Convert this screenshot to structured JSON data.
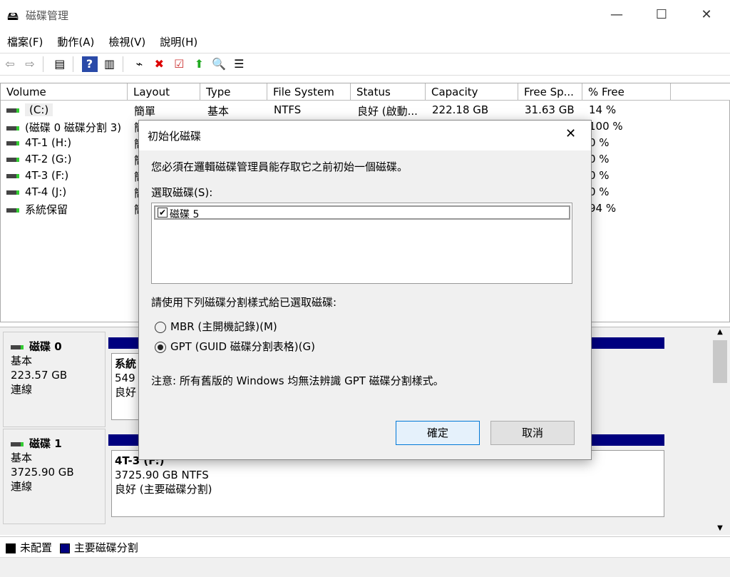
{
  "window": {
    "title": "磁碟管理",
    "minimize": "—",
    "maximize": "☐",
    "close": "✕"
  },
  "menu": [
    "檔案(F)",
    "動作(A)",
    "檢視(V)",
    "說明(H)"
  ],
  "columns": [
    "Volume",
    "Layout",
    "Type",
    "File System",
    "Status",
    "Capacity",
    "Free Sp...",
    "% Free"
  ],
  "volumes": [
    {
      "name": "(C:)",
      "layout": "簡單",
      "type": "基本",
      "fs": "NTFS",
      "status": "良好 (啟動...",
      "capacity": "222.18 GB",
      "free": "31.63 GB",
      "pct": "14 %"
    },
    {
      "name": "(磁碟 0 磁碟分割 3)",
      "layout": "簡",
      "pct": "100 %"
    },
    {
      "name": "4T-1 (H:)",
      "layout": "簡",
      "pct": "0 %"
    },
    {
      "name": "4T-2 (G:)",
      "layout": "簡",
      "pct": "0 %"
    },
    {
      "name": "4T-3 (F:)",
      "layout": "簡",
      "pct": "0 %"
    },
    {
      "name": "4T-4 (J:)",
      "layout": "簡",
      "pct": "0 %"
    },
    {
      "name": "系統保留",
      "layout": "簡",
      "pct": "94 %"
    }
  ],
  "disks": [
    {
      "name": "磁碟 0",
      "type": "基本",
      "size": "223.57 GB",
      "state": "連線",
      "part_name": "系統",
      "part_size": "549",
      "part_status": "良好"
    },
    {
      "name": "磁碟 1",
      "type": "基本",
      "size": "3725.90 GB",
      "state": "連線",
      "part_name": "4T-3 (F:)",
      "part_size": "3725.90 GB NTFS",
      "part_status": "良好 (主要磁碟分割)"
    }
  ],
  "legend": {
    "unallocated": "未配置",
    "primary": "主要磁碟分割",
    "colors": {
      "unallocated": "#000000",
      "primary": "#00007f"
    }
  },
  "dialog": {
    "title": "初始化磁碟",
    "close": "✕",
    "message": "您必須在邏輯磁碟管理員能存取它之前初始一個磁碟。",
    "select_label": "選取磁碟(S):",
    "disk_item": "磁碟 5",
    "disk_checked": true,
    "style_label": "請使用下列磁碟分割樣式給已選取磁碟:",
    "mbr": "MBR (主開機記錄)(M)",
    "gpt": "GPT (GUID 磁碟分割表格)(G)",
    "selected": "GPT",
    "note": "注意: 所有舊版的 Windows 均無法辨識 GPT 磁碟分割樣式。",
    "ok": "確定",
    "cancel": "取消"
  }
}
